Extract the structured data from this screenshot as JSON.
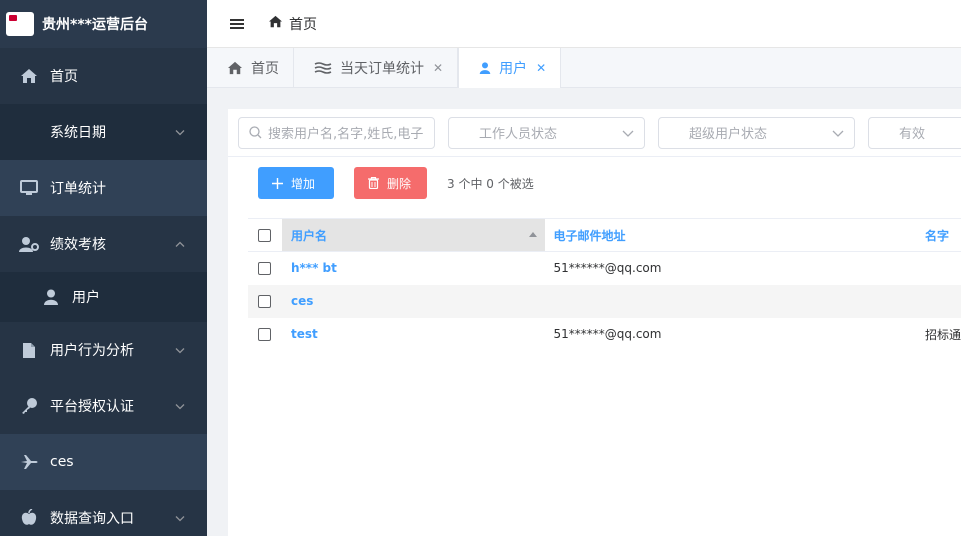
{
  "brand": {
    "title": "贵州***运营后台"
  },
  "sidebar": {
    "items": [
      {
        "label": "首页",
        "icon": "home-icon"
      },
      {
        "label": "系统日期",
        "icon": "chevron-down-icon"
      },
      {
        "label": "订单统计",
        "icon": "monitor-icon"
      },
      {
        "label": "绩效考核",
        "icon": "user-settings-icon"
      },
      {
        "label": "用户",
        "icon": "user-icon"
      },
      {
        "label": "用户行为分析",
        "icon": "file-icon"
      },
      {
        "label": "平台授权认证",
        "icon": "key-icon"
      },
      {
        "label": "ces",
        "icon": "plane-icon"
      },
      {
        "label": "数据查询入口",
        "icon": "apple-icon"
      }
    ]
  },
  "header": {
    "breadcrumb": "首页"
  },
  "tabs": [
    {
      "label": "首页",
      "icon": "home-icon"
    },
    {
      "label": "当天订单统计",
      "icon": "bars-icon"
    },
    {
      "label": "用户",
      "icon": "user-icon"
    }
  ],
  "filters": {
    "search_placeholder": "搜索用户名,名字,姓氏,电子",
    "staff_status_placeholder": "工作人员状态",
    "superuser_status_placeholder": "超级用户状态",
    "active_placeholder": "有效"
  },
  "toolbar": {
    "add_label": "增加",
    "delete_label": "删除",
    "selection_info": "3 个中 0 个被选"
  },
  "table": {
    "headers": [
      "用户名",
      "电子邮件地址",
      "名字"
    ],
    "rows": [
      {
        "username": "h*** bt",
        "email": "51******@qq.com",
        "name": ""
      },
      {
        "username": "ces",
        "email": "",
        "name": ""
      },
      {
        "username": "test",
        "email": "51******@qq.com",
        "name": "招标通"
      }
    ]
  },
  "colors": {
    "sidebar_bg": "#304156",
    "accent": "#409eff",
    "danger": "#f56c6c"
  }
}
